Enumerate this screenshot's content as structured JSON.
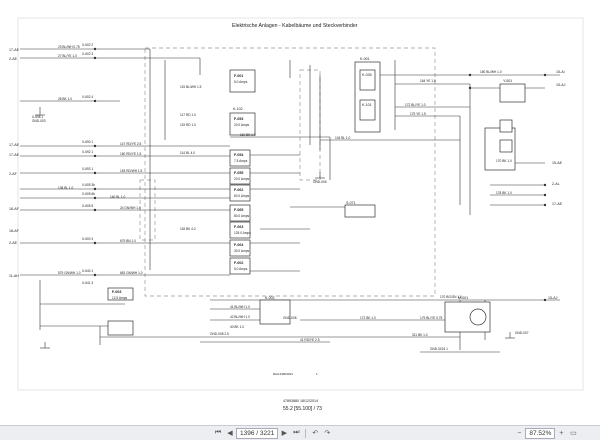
{
  "document": {
    "title": "Elektrische Anlagen - Kabelbäume und Steckverbinder",
    "footer_line1": "47893880 18/12/2014",
    "footer_line2": "55.2 [55.100] / 73",
    "small_mark": "RAIL23R0HN4",
    "small_num": "1"
  },
  "left_labels": [
    "17-AE",
    "2-AE",
    "17-AE",
    "17-AE",
    "2-AF",
    "18-AF",
    "18-AF",
    "2-AE",
    "11-AH"
  ],
  "left_wires": [
    "23 BL/WH 0.75",
    "27 BL/YE 1.0",
    "28 BK 1.0",
    "147 RD/YE 2.5",
    "150 RD/YE 1.5",
    "153 RD/WH 1.5",
    "138 BL 1.0",
    "140 BL 1.0",
    "24 GN/WH 1.0",
    "679 BN 1.0",
    "579 GN/WH 1.0",
    "681 GN/WH 1.0"
  ],
  "left_conns": [
    "X-602 2",
    "X-602 3",
    "X-602 4",
    "X-690 1",
    "X-692 1",
    "X-693 1",
    "X-605 3b",
    "X-605 6b",
    "X-605 5",
    "X-500 3",
    "X-640 1",
    "X-641 3"
  ],
  "ground_labels": [
    "X-698 1",
    "GND-003",
    "GND-006",
    "GND-008",
    "GND-007"
  ],
  "fuses": [
    {
      "id": "F-001",
      "rating": "5.0 Amps"
    },
    {
      "id": "F-053",
      "rating": "20.0 Amps"
    },
    {
      "id": "F-054",
      "rating": "7.5 Amps"
    },
    {
      "id": "F-055",
      "rating": "20.0 Amps"
    },
    {
      "id": "F-062",
      "rating": "60.0 Amps"
    },
    {
      "id": "F-065",
      "rating": "80.0 Amps"
    },
    {
      "id": "F-063",
      "rating": "125.0 Amps"
    },
    {
      "id": "F-064",
      "rating": "30.0 Amps"
    },
    {
      "id": "F-002",
      "rating": "5.0 Amps"
    },
    {
      "id": "F-003",
      "rating": "12.5 Amps"
    }
  ],
  "relays": [
    "K-001",
    "K-035",
    "K-101",
    "K-102",
    "K-002",
    "M-001",
    "Y-001",
    "S-071"
  ],
  "right_labels": [
    "15-AI",
    "15-AJ",
    "15-AE",
    "2-AL",
    "17-AE",
    "15-AJ"
  ],
  "right_wires": [
    "180 BL/WH 1.0",
    "164 YE 1.5",
    "172 BL/YE 1.0",
    "179 YE 1.5",
    "170 BK 1.0",
    "178 BK 1.0",
    "170 BG/GN 1.0",
    "311 BK 1.0",
    "179 BL/YE 0.75",
    "GND-0024 1"
  ],
  "mid_wires": [
    "115 BL/WH 1.5",
    "117 RD 1.0",
    "119 RD 1.0",
    "104 BL 1.0",
    "110 BK 1.0",
    "114 BL 4.0",
    "118 BK 4.0",
    "41 BL/WH 1.0",
    "42 BL/WH 1.0",
    "40 BK 1.0",
    "GND-008 2.5",
    "172 BK 1.0",
    "41 RD/YE 2.5"
  ],
  "statusbar": {
    "page_field": "1396 / 3221",
    "zoom": "87.52%"
  }
}
